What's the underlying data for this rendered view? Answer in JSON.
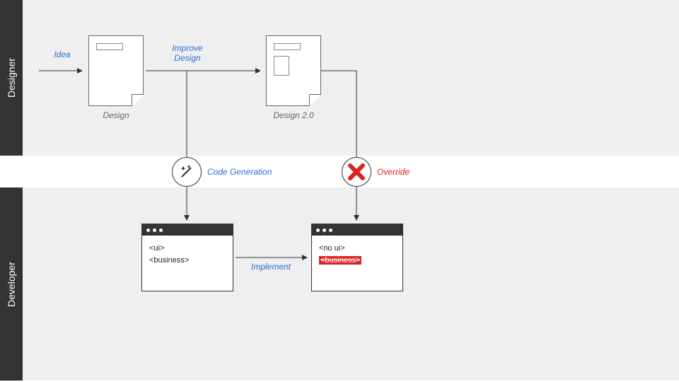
{
  "lanes": {
    "top": "Designer",
    "bottom": "Developer"
  },
  "docs": {
    "design1_caption": "Design",
    "design2_caption": "Design 2.0"
  },
  "flows": {
    "idea": "Idea",
    "improve_l1": "Improve",
    "improve_l2": "Design",
    "implement": "Implement"
  },
  "icons": {
    "codegen_label": "Code Generation",
    "override_label": "Override"
  },
  "code": {
    "left_line1": "<ui>",
    "left_line2": "<business>",
    "right_line1": "<no ui>",
    "right_line2": "<business>"
  },
  "colors": {
    "accent": "#2b6adb",
    "danger": "#d22"
  }
}
